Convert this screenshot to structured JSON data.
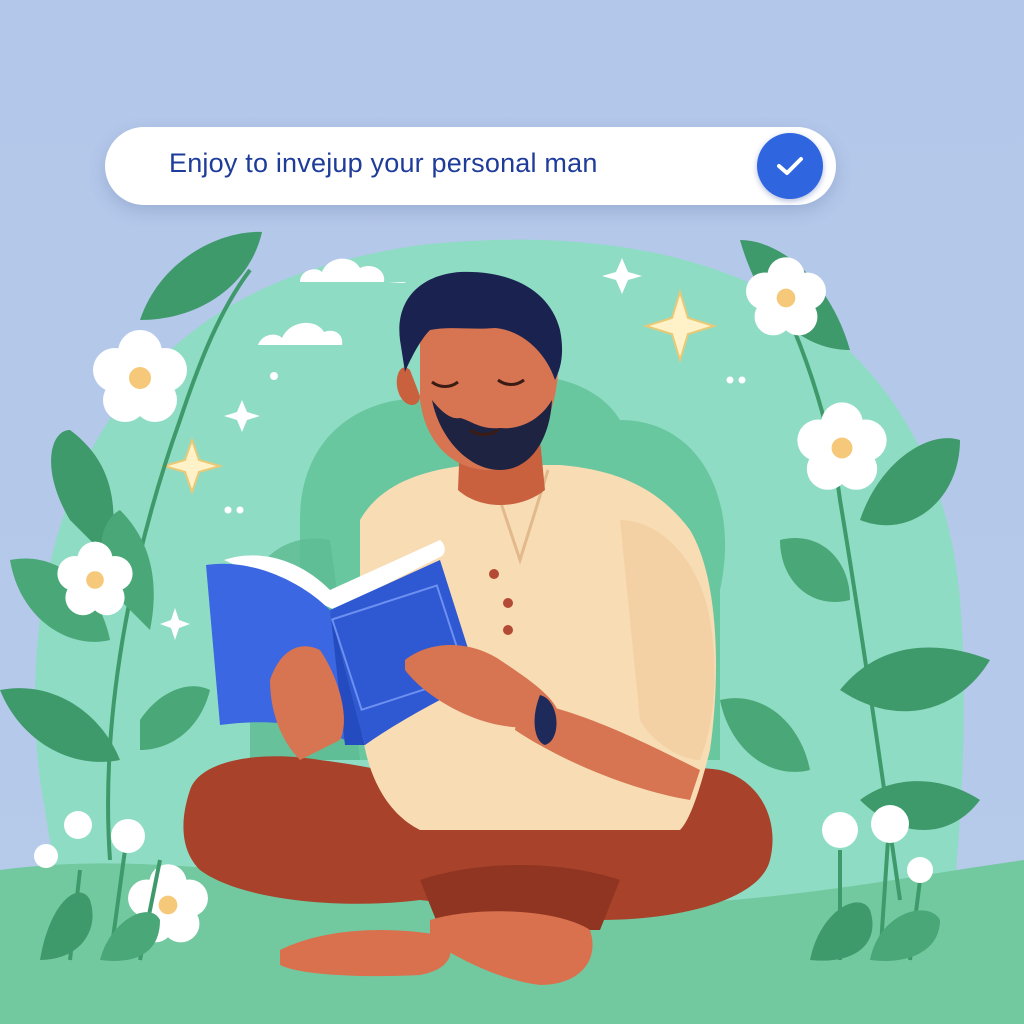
{
  "banner": {
    "text": "Enjoy to invejup your  personal man",
    "confirm_icon": "checkmark-icon"
  },
  "colors": {
    "background": "#b4c8e8",
    "bush": "#8fdcc4",
    "leaf": "#3f9a6b",
    "shirt": "#f8dcb4",
    "pants": "#a8422a",
    "book": "#3c67e2",
    "accent": "#2f66e0",
    "banner_text": "#1e3c9a"
  }
}
